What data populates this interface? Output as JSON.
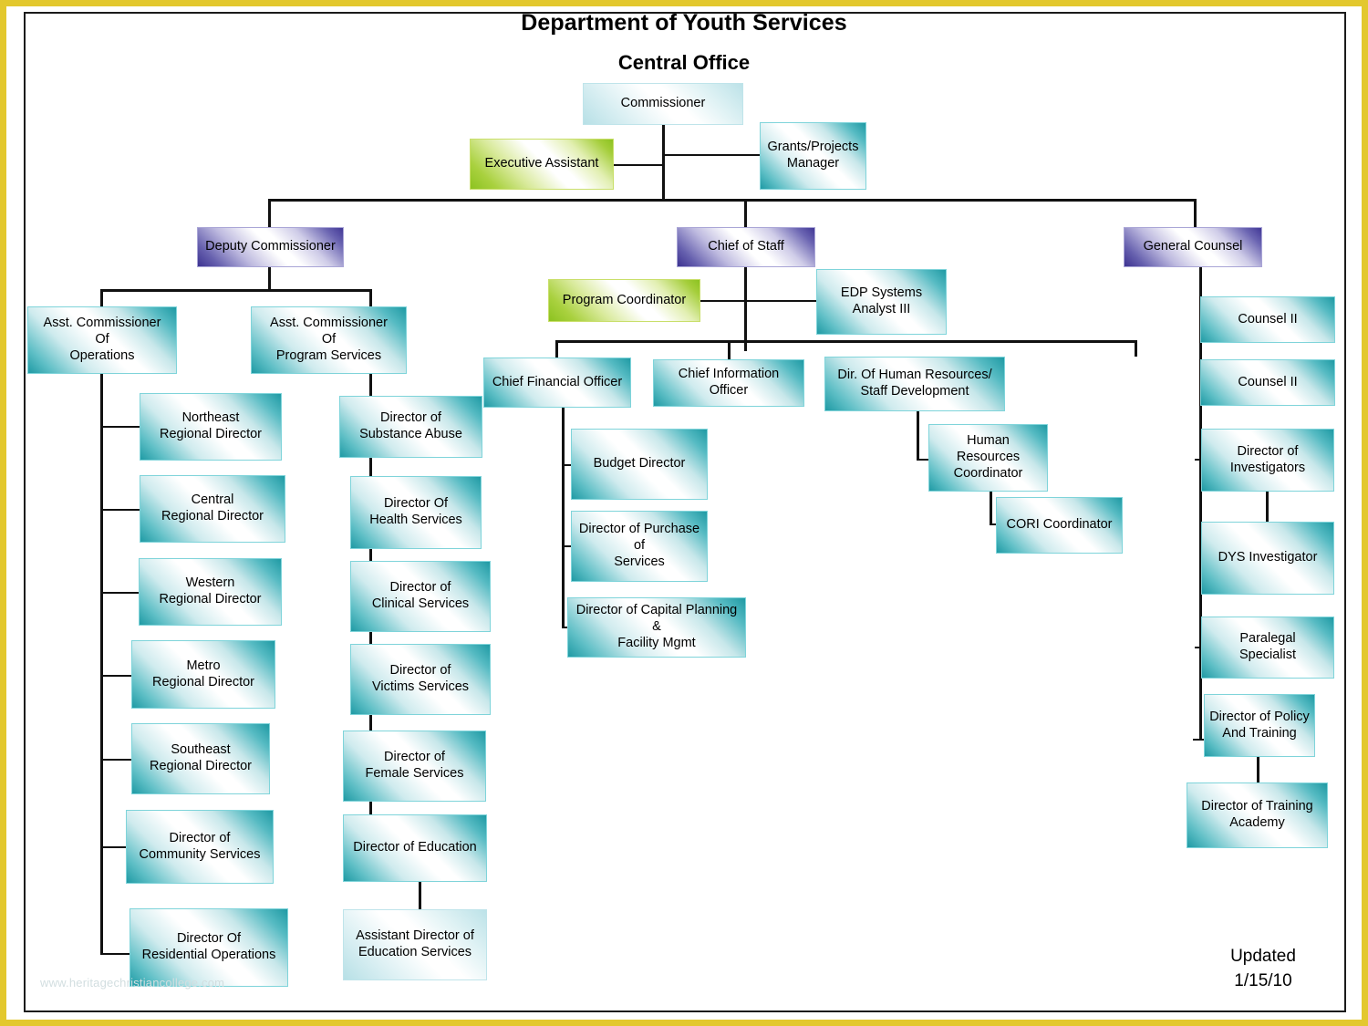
{
  "document": {
    "title": "Department of Youth Services",
    "subtitle": "Central Office",
    "updated": "Updated\n1/15/10",
    "watermark": "www.heritagechristiancollege.com",
    "frame_color_outer": "#E3C82E",
    "frame_color_inner": "#1b1b1b"
  },
  "palette": {
    "teal": "#1F9AA4",
    "teal_light": "#B7E0E6",
    "purple": "#3D3391",
    "green": "#8CC220",
    "connector": "#111111"
  },
  "chart_data": {
    "type": "org-chart",
    "title": "Department of Youth Services — Central Office",
    "nodes": [
      {
        "id": "commissioner",
        "label": "Commissioner",
        "style": "teal-light",
        "parent": null
      },
      {
        "id": "executive-assistant",
        "label": "Executive Assistant",
        "style": "green",
        "parent": "commissioner"
      },
      {
        "id": "grants-projects-manager",
        "label": "Grants/Projects\nManager",
        "style": "teal",
        "parent": "commissioner"
      },
      {
        "id": "deputy-commissioner",
        "label": "Deputy Commissioner",
        "style": "purple",
        "parent": "commissioner"
      },
      {
        "id": "chief-of-staff",
        "label": "Chief of Staff",
        "style": "purple",
        "parent": "commissioner"
      },
      {
        "id": "general-counsel",
        "label": "General Counsel",
        "style": "purple",
        "parent": "commissioner"
      },
      {
        "id": "asst-commissioner-operations",
        "label": "Asst. Commissioner\nOf\nOperations",
        "style": "teal",
        "parent": "deputy-commissioner"
      },
      {
        "id": "asst-commissioner-program-services",
        "label": "Asst.  Commissioner\nOf\nProgram Services",
        "style": "teal",
        "parent": "deputy-commissioner"
      },
      {
        "id": "northeast-regional-director",
        "label": "Northeast\nRegional Director",
        "style": "teal",
        "parent": "asst-commissioner-operations"
      },
      {
        "id": "central-regional-director",
        "label": "Central\nRegional Director",
        "style": "teal",
        "parent": "asst-commissioner-operations"
      },
      {
        "id": "western-regional-director",
        "label": "Western\nRegional Director",
        "style": "teal",
        "parent": "asst-commissioner-operations"
      },
      {
        "id": "metro-regional-director",
        "label": "Metro\nRegional Director",
        "style": "teal",
        "parent": "asst-commissioner-operations"
      },
      {
        "id": "southeast-regional-director",
        "label": "Southeast\nRegional Director",
        "style": "teal",
        "parent": "asst-commissioner-operations"
      },
      {
        "id": "director-community-services",
        "label": "Director of\nCommunity Services",
        "style": "teal",
        "parent": "asst-commissioner-operations"
      },
      {
        "id": "director-residential-operations",
        "label": "Director Of\nResidential Operations",
        "style": "teal",
        "parent": "asst-commissioner-operations"
      },
      {
        "id": "director-substance-abuse",
        "label": "Director of\nSubstance Abuse",
        "style": "teal",
        "parent": "asst-commissioner-program-services"
      },
      {
        "id": "director-health-services",
        "label": "Director Of\nHealth Services",
        "style": "teal",
        "parent": "asst-commissioner-program-services"
      },
      {
        "id": "director-clinical-services",
        "label": "Director of\nClinical Services",
        "style": "teal",
        "parent": "asst-commissioner-program-services"
      },
      {
        "id": "director-victims-services",
        "label": "Director of\nVictims Services",
        "style": "teal",
        "parent": "asst-commissioner-program-services"
      },
      {
        "id": "director-female-services",
        "label": "Director of\nFemale Services",
        "style": "teal",
        "parent": "asst-commissioner-program-services"
      },
      {
        "id": "director-education",
        "label": "Director of Education",
        "style": "teal",
        "parent": "asst-commissioner-program-services"
      },
      {
        "id": "assistant-director-education-services",
        "label": "Assistant Director of\nEducation Services",
        "style": "teal-light",
        "parent": "director-education"
      },
      {
        "id": "program-coordinator",
        "label": "Program Coordinator",
        "style": "green",
        "parent": "chief-of-staff"
      },
      {
        "id": "edp-systems-analyst",
        "label": "EDP Systems\nAnalyst III",
        "style": "teal",
        "parent": "chief-of-staff"
      },
      {
        "id": "chief-financial-officer",
        "label": "Chief Financial Officer",
        "style": "teal",
        "parent": "chief-of-staff"
      },
      {
        "id": "chief-information-officer",
        "label": "Chief Information Officer",
        "style": "teal",
        "parent": "chief-of-staff"
      },
      {
        "id": "dir-human-resources",
        "label": "Dir. Of Human Resources/\nStaff Development",
        "style": "teal",
        "parent": "chief-of-staff"
      },
      {
        "id": "budget-director",
        "label": "Budget Director",
        "style": "teal",
        "parent": "chief-financial-officer"
      },
      {
        "id": "director-purchase-of-services",
        "label": "Director of Purchase of\nServices",
        "style": "teal",
        "parent": "chief-financial-officer"
      },
      {
        "id": "director-capital-planning",
        "label": "Director of Capital Planning &\nFacility Mgmt",
        "style": "teal",
        "parent": "chief-financial-officer"
      },
      {
        "id": "human-resources-coordinator",
        "label": "Human Resources\nCoordinator",
        "style": "teal",
        "parent": "dir-human-resources"
      },
      {
        "id": "cori-coordinator",
        "label": "CORI Coordinator",
        "style": "teal",
        "parent": "human-resources-coordinator"
      },
      {
        "id": "counsel-ii-1",
        "label": "Counsel II",
        "style": "teal",
        "parent": "general-counsel"
      },
      {
        "id": "counsel-ii-2",
        "label": "Counsel II",
        "style": "teal",
        "parent": "general-counsel"
      },
      {
        "id": "director-of-investigators",
        "label": "Director of\nInvestigators",
        "style": "teal",
        "parent": "general-counsel"
      },
      {
        "id": "dys-investigator",
        "label": "DYS Investigator",
        "style": "teal",
        "parent": "director-of-investigators"
      },
      {
        "id": "paralegal-specialist",
        "label": "Paralegal\nSpecialist",
        "style": "teal",
        "parent": "general-counsel"
      },
      {
        "id": "director-policy-training",
        "label": "Director of Policy\nAnd Training",
        "style": "teal",
        "parent": "general-counsel"
      },
      {
        "id": "director-training-academy",
        "label": "Director of Training\nAcademy",
        "style": "teal",
        "parent": "director-policy-training"
      }
    ]
  }
}
